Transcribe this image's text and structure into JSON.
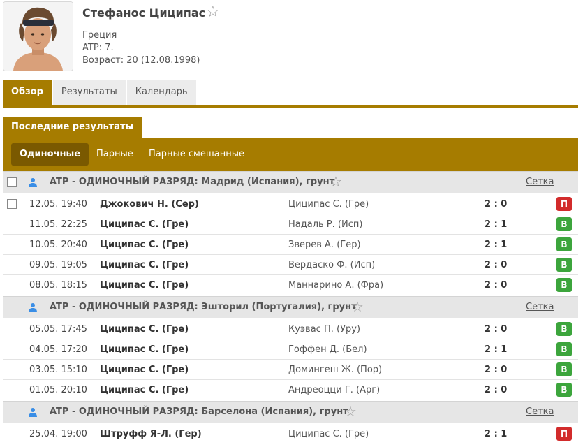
{
  "player": {
    "name": "Стефанос Циципас",
    "country": "Греция",
    "atp": "ATP: 7.",
    "age": "Возраст: 20 (12.08.1998)"
  },
  "tabs": [
    "Обзор",
    "Результаты",
    "Календарь"
  ],
  "section_title": "Последние результаты",
  "subtabs": [
    "Одиночные",
    "Парные",
    "Парные смешанные"
  ],
  "setka_label": "Сетка",
  "icons": {
    "star": "☆",
    "win": "В",
    "loss": "П"
  },
  "colors": {
    "accent": "#a67c00",
    "accent_dark": "#7a5900",
    "win": "#3ca53c",
    "loss": "#d22b2b"
  },
  "tournaments": [
    {
      "title": "ATP - ОДИНОЧНЫЙ РАЗРЯД: Мадрид (Испания), грунт",
      "matches": [
        {
          "time": "12.05. 19:40",
          "home": "Джокович Н. (Сер)",
          "away": "Циципас С. (Гре)",
          "score": "2 : 0",
          "result": "П",
          "winner": "home"
        },
        {
          "time": "11.05. 22:25",
          "home": "Циципас С. (Гре)",
          "away": "Надаль Р. (Исп)",
          "score": "2 : 1",
          "result": "В",
          "winner": "home"
        },
        {
          "time": "10.05. 20:40",
          "home": "Циципас С. (Гре)",
          "away": "Зверев А. (Гер)",
          "score": "2 : 1",
          "result": "В",
          "winner": "home"
        },
        {
          "time": "09.05. 19:05",
          "home": "Циципас С. (Гре)",
          "away": "Вердаско Ф. (Исп)",
          "score": "2 : 0",
          "result": "В",
          "winner": "home"
        },
        {
          "time": "08.05. 18:15",
          "home": "Циципас С. (Гре)",
          "away": "Маннарино А. (Фра)",
          "score": "2 : 0",
          "result": "В",
          "winner": "home"
        }
      ]
    },
    {
      "title": "ATP - ОДИНОЧНЫЙ РАЗРЯД: Эшторил (Португалия), грунт",
      "matches": [
        {
          "time": "05.05. 17:45",
          "home": "Циципас С. (Гре)",
          "away": "Куэвас П. (Уру)",
          "score": "2 : 0",
          "result": "В",
          "winner": "home"
        },
        {
          "time": "04.05. 17:20",
          "home": "Циципас С. (Гре)",
          "away": "Гоффен Д. (Бел)",
          "score": "2 : 1",
          "result": "В",
          "winner": "home"
        },
        {
          "time": "03.05. 15:10",
          "home": "Циципас С. (Гре)",
          "away": "Домингеш Ж. (Пор)",
          "score": "2 : 0",
          "result": "В",
          "winner": "home"
        },
        {
          "time": "01.05. 20:10",
          "home": "Циципас С. (Гре)",
          "away": "Андреоцци Г. (Арг)",
          "score": "2 : 0",
          "result": "В",
          "winner": "home"
        }
      ]
    },
    {
      "title": "ATP - ОДИНОЧНЫЙ РАЗРЯД: Барселона (Испания), грунт",
      "matches": [
        {
          "time": "25.04. 19:00",
          "home": "Штруфф Я-Л. (Гер)",
          "away": "Циципас С. (Гре)",
          "score": "2 : 1",
          "result": "П",
          "winner": "home"
        }
      ]
    }
  ]
}
